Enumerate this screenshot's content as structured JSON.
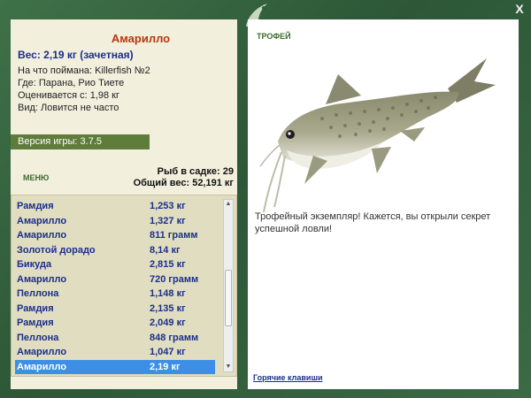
{
  "window": {
    "close_label": "X"
  },
  "catch_info": {
    "fish_name": "Амарилло",
    "weight_line": "Вес: 2,19 кг (зачетная)",
    "lines": [
      "На что поймана: Killerfish №2",
      "Где: Парана, Рио Тиете",
      "Оценивается с: 1,98 кг",
      "Вид: Ловится не часто"
    ]
  },
  "version": "Версия игры: 3.7.5",
  "menu_label": "МЕНЮ",
  "stats": {
    "fish_count": "Рыб в садке: 29",
    "total_weight": "Общий вес: 52,191 кг"
  },
  "catch_list": [
    {
      "name": "Рамдия",
      "weight": "1,253 кг"
    },
    {
      "name": "Амарилло",
      "weight": "1,327 кг"
    },
    {
      "name": "Амарилло",
      "weight": "811 грамм"
    },
    {
      "name": "Золотой дорадо",
      "weight": "8,14 кг"
    },
    {
      "name": "Бикуда",
      "weight": "2,815 кг"
    },
    {
      "name": "Амарилло",
      "weight": "720 грамм"
    },
    {
      "name": "Пеллона",
      "weight": "1,148 кг"
    },
    {
      "name": "Рамдия",
      "weight": "2,135 кг"
    },
    {
      "name": "Рамдия",
      "weight": "2,049 кг"
    },
    {
      "name": "Пеллона",
      "weight": "848 грамм"
    },
    {
      "name": "Амарилло",
      "weight": "1,047 кг"
    },
    {
      "name": "Амарилло",
      "weight": "2,19 кг",
      "selected": true
    }
  ],
  "scrollbar": {
    "position": 0.62
  },
  "trophy": {
    "title": "ТРОФЕЙ",
    "text": "Трофейный экземпляр! Кажется, вы открыли секрет успешной ловли!"
  },
  "hotkeys_label": "Горячие клавиши",
  "colors": {
    "frame": "#2f5a3a",
    "selected_row": "#3d8fe6",
    "fish_name": "#b5380f",
    "weight_text": "#1a2f8c",
    "version_bar": "#5e7c3a"
  }
}
